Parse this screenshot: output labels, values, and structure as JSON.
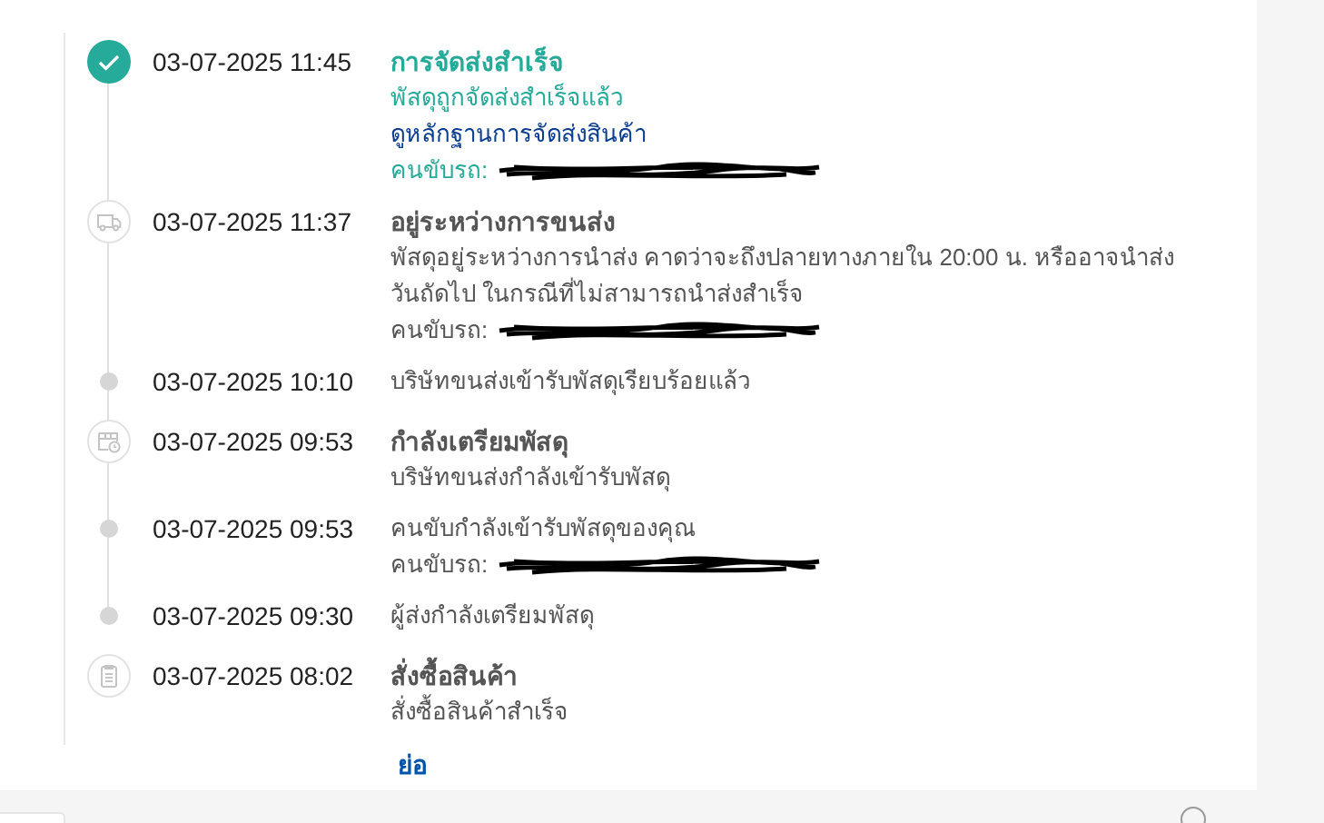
{
  "events": [
    {
      "time": "03-07-2025 11:45",
      "kind": "check",
      "highlight": true,
      "lines": [
        {
          "kind": "title",
          "text": "การจัดส่งสำเร็จ"
        },
        {
          "kind": "text",
          "text": "พัสดุถูกจัดส่งสำเร็จแล้ว"
        },
        {
          "kind": "link",
          "text": "ดูหลักฐานการจัดส่งสินค้า"
        },
        {
          "kind": "driver",
          "text": "คนขับรถ:"
        }
      ]
    },
    {
      "time": "03-07-2025 11:37",
      "kind": "truck",
      "highlight": false,
      "lines": [
        {
          "kind": "title",
          "text": "อยู่ระหว่างการขนส่ง"
        },
        {
          "kind": "text",
          "text": "พัสดุอยู่ระหว่างการนำส่ง คาดว่าจะถึงปลายทางภายใน 20:00 น. หรืออาจนำส่งวันถัดไป ในกรณีที่ไม่สามารถนำส่งสำเร็จ"
        },
        {
          "kind": "driver",
          "text": "คนขับรถ:"
        }
      ]
    },
    {
      "time": "03-07-2025 10:10",
      "kind": "dot",
      "highlight": false,
      "lines": [
        {
          "kind": "text",
          "text": "บริษัทขนส่งเข้ารับพัสดุเรียบร้อยแล้ว"
        }
      ]
    },
    {
      "time": "03-07-2025 09:53",
      "kind": "parcel",
      "highlight": false,
      "lines": [
        {
          "kind": "title",
          "text": "กำลังเตรียมพัสดุ"
        },
        {
          "kind": "text",
          "text": "บริษัทขนส่งกำลังเข้ารับพัสดุ"
        }
      ]
    },
    {
      "time": "03-07-2025 09:53",
      "kind": "dot",
      "highlight": false,
      "lines": [
        {
          "kind": "text",
          "text": "คนขับกำลังเข้ารับพัสดุของคุณ"
        },
        {
          "kind": "driver",
          "text": "คนขับรถ:"
        }
      ]
    },
    {
      "time": "03-07-2025 09:30",
      "kind": "dot",
      "highlight": false,
      "lines": [
        {
          "kind": "text",
          "text": "ผู้ส่งกำลังเตรียมพัสดุ"
        }
      ]
    },
    {
      "time": "03-07-2025 08:02",
      "kind": "clipboard",
      "highlight": false,
      "lines": [
        {
          "kind": "title",
          "text": "สั่งซื้อสินค้า"
        },
        {
          "kind": "text",
          "text": "สั่งซื้อสินค้าสำเร็จ"
        }
      ]
    }
  ],
  "collapse_link": "ย่อ"
}
